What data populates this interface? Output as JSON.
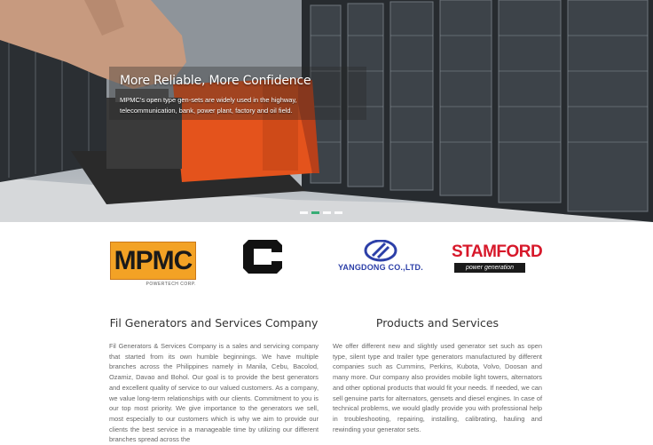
{
  "hero": {
    "title": "More Reliable, More Confidence",
    "text": "MPMC's open type gen-sets are widely used in the highway, telecommunication, bank, power plant, factory and oil field.",
    "slides": [
      {
        "label": "1",
        "active": false
      },
      {
        "label": "2",
        "active": true
      },
      {
        "label": "3",
        "active": false
      },
      {
        "label": "4",
        "active": false
      }
    ]
  },
  "logos": {
    "mpmc": {
      "name": "MPMC",
      "sub": "POWERTECH CORP."
    },
    "cummins": {
      "name": "Cummins"
    },
    "yangdong": {
      "name": "YANGDONG CO.,LTD."
    },
    "stamford": {
      "name": "STAMFORD",
      "tagline": "power generation"
    }
  },
  "sections": [
    {
      "title": "Fil Generators and Services Company",
      "body": "Fil Generators & Services Company is a sales and servicing company that started from its own humble beginnings. We have multiple branches across the Philippines namely in Manila, Cebu, Bacolod, Ozamiz, Davao and Bohol. Our goal is to provide the best generators and excellent quality of service to our valued customers. As a company, we value long-term relationships with our clients. Commitment to you is our top most priority. We give importance to the generators we sell, most especially to our customers which is why we aim to provide our clients the best service in a manageable time by utilizing our different branches spread across the"
    },
    {
      "title": "Products and Services",
      "body": "We offer different new and slightly used generator set such as open type, silent type and trailer type generators manufactured by different companies such as Cummins, Perkins, Kubota, Volvo, Doosan and many more. Our company also provides mobile light towers, alternators and other optional products that would fit your needs. If needed, we can sell genuine parts for alternators, gensets and diesel engines. In case of technical problems, we would gladly provide you with professional help in troubleshooting, repairing, installing, calibrating, hauling and rewinding your generator sets."
    }
  ],
  "colors": {
    "accent": "#27a86a",
    "mpmc_orange": "#f3a225",
    "stamford_red": "#d7182a",
    "yangdong_blue": "#2c3fa8"
  }
}
